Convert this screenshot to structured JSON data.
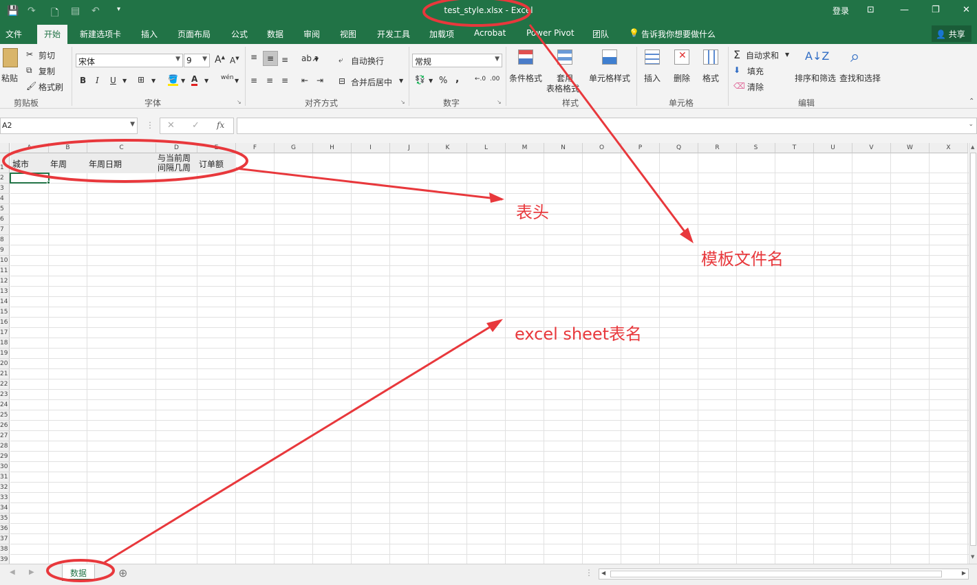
{
  "window": {
    "title": "test_style.xlsx - Excel",
    "login": "登录",
    "controls": [
      "⊡",
      "—",
      "❐",
      "✕"
    ]
  },
  "menu": {
    "items": [
      "文件",
      "开始",
      "新建选项卡",
      "插入",
      "页面布局",
      "公式",
      "数据",
      "审阅",
      "视图",
      "开发工具",
      "加载项",
      "Acrobat",
      "Power Pivot",
      "团队"
    ],
    "active": "开始",
    "tell_me": "告诉我你想要做什么",
    "share": "共享"
  },
  "ribbon": {
    "clipboard": {
      "paste": "粘贴",
      "cut": "剪切",
      "copy": "复制",
      "format_painter": "格式刷",
      "label": "剪贴板"
    },
    "font": {
      "name": "宋体",
      "size": "9",
      "bold": "B",
      "italic": "I",
      "underline": "U",
      "wen": "wén",
      "label": "字体"
    },
    "alignment": {
      "wrap": "自动换行",
      "merge": "合并后居中",
      "label": "对齐方式"
    },
    "number": {
      "format": "常规",
      "percent": "%",
      "comma": ",",
      "label": "数字"
    },
    "styles": {
      "conditional": "条件格式",
      "table_format_1": "套用",
      "table_format_2": "表格格式",
      "cell_styles": "单元格样式",
      "label": "样式"
    },
    "cells": {
      "insert": "插入",
      "delete": "删除",
      "format": "格式",
      "label": "单元格"
    },
    "editing": {
      "autosum": "自动求和",
      "fill": "填充",
      "clear": "清除",
      "sort": "排序和筛选",
      "find": "查找和选择",
      "label": "编辑"
    }
  },
  "formula_bar": {
    "name_box": "A2",
    "fx": "fx",
    "cancel": "✕",
    "enter": "✓",
    "formula": ""
  },
  "sheet": {
    "columns": [
      "A",
      "B",
      "C",
      "D",
      "E",
      "F",
      "G",
      "H",
      "I",
      "J",
      "K",
      "L",
      "M",
      "N",
      "O",
      "P",
      "Q",
      "R",
      "S",
      "T",
      "U",
      "V",
      "W",
      "X"
    ],
    "rows": [
      "1",
      "2",
      "3",
      "4",
      "5",
      "6",
      "7",
      "8",
      "9",
      "10",
      "11",
      "12",
      "13",
      "14",
      "15",
      "16",
      "17",
      "18",
      "19",
      "20",
      "21",
      "22",
      "23",
      "24",
      "25",
      "26",
      "27",
      "28",
      "29",
      "30",
      "31",
      "32",
      "33",
      "34",
      "35",
      "36",
      "37",
      "38",
      "39"
    ],
    "header_cells": [
      "城市",
      "年周",
      "年周日期",
      "与当前周\n间隔几周",
      "订单额"
    ],
    "selected_cell": "A2"
  },
  "tabs": {
    "active": "数据"
  },
  "annotations": {
    "header": "表头",
    "template_name": "模板文件名",
    "sheet_name": "excel sheet表名"
  },
  "colors": {
    "excel_green": "#217346",
    "annotation_red": "#e8383c"
  }
}
